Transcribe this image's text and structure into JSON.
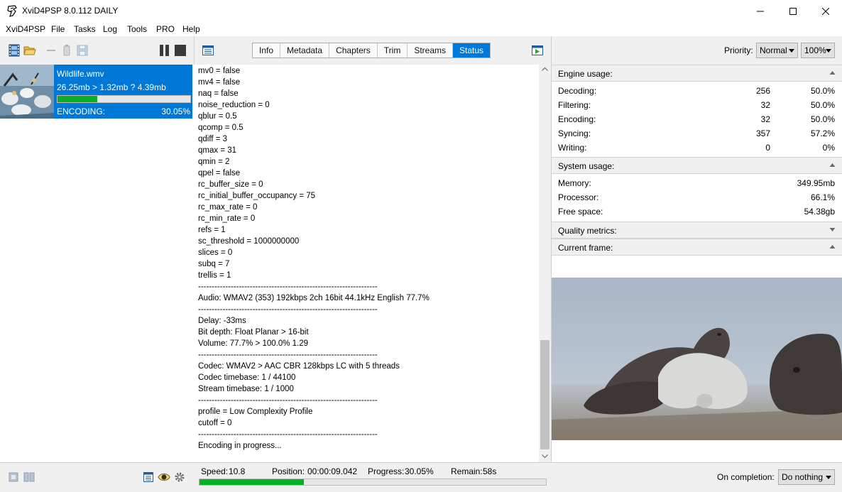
{
  "window": {
    "title": "XviD4PSP 8.0.112 DAILY",
    "minimize": "─",
    "maximize": "☐",
    "close": "✕"
  },
  "menu": [
    "XviD4PSP",
    "File",
    "Tasks",
    "Log",
    "Tools",
    "PRO",
    "Help"
  ],
  "tabs": [
    "Info",
    "Metadata",
    "Chapters",
    "Trim",
    "Streams",
    "Status"
  ],
  "active_tab": "Status",
  "task": {
    "name": "Wildlife.wmv",
    "info": "26.25mb > 1.32mb ? 4.39mb",
    "status": "ENCODING:",
    "percent": "30.05%",
    "progress": 0.3005
  },
  "log_lines": [
    "mv0 = false",
    "mv4 = false",
    "naq = false",
    "noise_reduction = 0",
    "qblur = 0.5",
    "qcomp = 0.5",
    "qdiff = 3",
    "qmax = 31",
    "qmin = 2",
    "qpel = false",
    "rc_buffer_size = 0",
    "rc_initial_buffer_occupancy = 75",
    "rc_max_rate = 0",
    "rc_min_rate = 0",
    "refs = 1",
    "sc_threshold = 1000000000",
    "slices = 0",
    "subq = 7",
    "trellis = 1",
    "------------------------------------------------------------------",
    "Audio: WMAV2 (353) 192kbps 2ch 16bit 44.1kHz English 77.7%",
    "------------------------------------------------------------------",
    "Delay: -33ms",
    "Bit depth: Float Planar > 16-bit",
    "Volume: 77.7% > 100.0% 1.29",
    "------------------------------------------------------------------",
    "Codec: WMAV2 > AAC CBR 128kbps LC with 5 threads",
    "Codec timebase: 1 / 44100",
    "Stream timebase: 1 / 1000",
    "------------------------------------------------------------------",
    "profile = Low Complexity Profile",
    "cutoff = 0",
    "------------------------------------------------------------------",
    "Encoding in progress..."
  ],
  "priority": {
    "label": "Priority:",
    "value": "Normal",
    "percent": "100%"
  },
  "engine_usage": {
    "title": "Engine usage:",
    "rows": [
      {
        "k": "Decoding:",
        "v1": "256",
        "v2": "50.0%"
      },
      {
        "k": "Filtering:",
        "v1": "32",
        "v2": "50.0%"
      },
      {
        "k": "Encoding:",
        "v1": "32",
        "v2": "50.0%"
      },
      {
        "k": "Syncing:",
        "v1": "357",
        "v2": "57.2%"
      },
      {
        "k": "Writing:",
        "v1": "0",
        "v2": "0%"
      }
    ]
  },
  "system_usage": {
    "title": "System usage:",
    "rows": [
      {
        "k": "Memory:",
        "v2": "349.95mb"
      },
      {
        "k": "Processor:",
        "v2": "66.1%"
      },
      {
        "k": "Free space:",
        "v2": "54.38gb"
      }
    ]
  },
  "quality_metrics": {
    "title": "Quality metrics:"
  },
  "current_frame": {
    "title": "Current frame:"
  },
  "bottom": {
    "speed_label": "Speed:",
    "speed": "10.8",
    "position_label": "Position:",
    "position": "00:00:09.042",
    "progress_label": "Progress:",
    "progress": "30.05%",
    "progress_fraction": 0.3005,
    "remain_label": "Remain:",
    "remain": "58s",
    "completion_label": "On completion:",
    "completion_value": "Do nothing"
  },
  "colors": {
    "accent": "#0078d7",
    "progress_green": "#06b025"
  }
}
